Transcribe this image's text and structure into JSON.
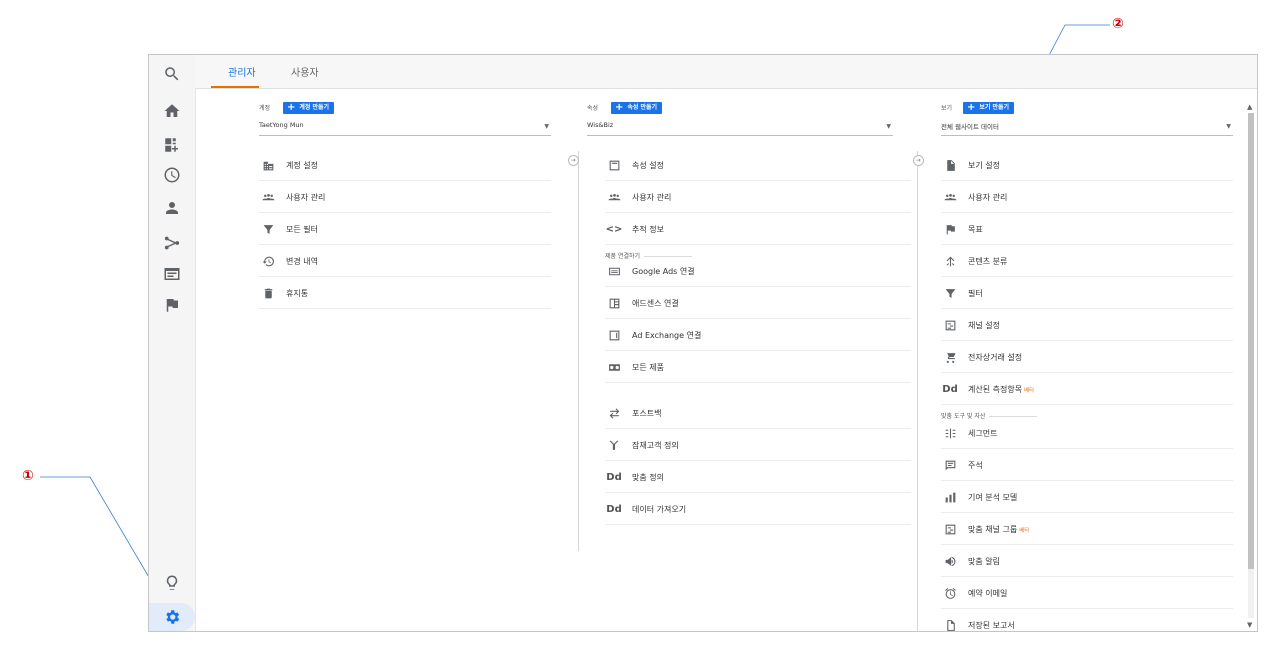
{
  "tabs": [
    {
      "label": "관리자"
    },
    {
      "label": "사용자"
    }
  ],
  "account": {
    "header": "계정",
    "create_label": "계정 만들기",
    "selected": "TaetYong Mun",
    "items": [
      {
        "label": "계정 설정",
        "icon": "building-icon"
      },
      {
        "label": "사용자 관리",
        "icon": "people-icon"
      },
      {
        "label": "모든 필터",
        "icon": "filter-icon"
      },
      {
        "label": "변경 내역",
        "icon": "history-icon"
      },
      {
        "label": "휴지통",
        "icon": "trash-icon"
      }
    ]
  },
  "property": {
    "header": "속성",
    "create_label": "속성 만들기",
    "selected": "Wis&Biz",
    "items": [
      {
        "label": "속성 설정",
        "icon": "window-icon"
      },
      {
        "label": "사용자 관리",
        "icon": "people-icon"
      },
      {
        "label": "추적 정보",
        "icon": "code-icon"
      }
    ],
    "product_section": "제품 연결하기",
    "product_items": [
      {
        "label": "Google Ads 연결",
        "icon": "ads-icon"
      },
      {
        "label": "애드센스 연결",
        "icon": "adsense-icon"
      },
      {
        "label": "Ad Exchange 연결",
        "icon": "window-icon"
      },
      {
        "label": "모든 제품",
        "icon": "all-products-icon"
      }
    ],
    "extra_items": [
      {
        "label": "포스트백",
        "icon": "postback-icon"
      },
      {
        "label": "잠재고객 정의",
        "icon": "audience-icon"
      },
      {
        "label": "맞춤 정의",
        "icon": "dd-icon",
        "glyph": "Dd"
      },
      {
        "label": "데이터 가져오기",
        "icon": "dd-icon",
        "glyph": "Dd"
      }
    ]
  },
  "view": {
    "header": "보기",
    "create_label": "보기 만들기",
    "selected": "전체 웹사이트 데이터",
    "items": [
      {
        "label": "보기 설정",
        "icon": "document-icon"
      },
      {
        "label": "사용자 관리",
        "icon": "people-icon"
      },
      {
        "label": "목표",
        "icon": "flag-icon"
      },
      {
        "label": "콘텐츠 분류",
        "icon": "grouping-icon"
      },
      {
        "label": "필터",
        "icon": "filter-icon"
      },
      {
        "label": "채널 설정",
        "icon": "channel-icon"
      },
      {
        "label": "전자상거래 설정",
        "icon": "cart-icon"
      },
      {
        "label": "계산된 측정항목",
        "icon": "dd-icon",
        "glyph": "Dd",
        "badge": "베타"
      }
    ],
    "tools_section": "맞춤 도구 및 자산",
    "tools_items": [
      {
        "label": "세그먼트",
        "icon": "segment-icon"
      },
      {
        "label": "주석",
        "icon": "comment-icon"
      },
      {
        "label": "기여 분석 모델",
        "icon": "bar-chart-icon"
      },
      {
        "label": "맞춤 채널 그룹",
        "icon": "channel-icon",
        "badge": "베타"
      },
      {
        "label": "맞춤 알림",
        "icon": "megaphone-icon"
      },
      {
        "label": "예약 이메일",
        "icon": "alarm-icon"
      },
      {
        "label": "저장된 보고서",
        "icon": "saved-report-icon"
      }
    ]
  },
  "callouts": {
    "one": "①",
    "two": "②"
  },
  "colors": {
    "accent": "#1a73e8",
    "tab_underline": "#e37400",
    "beta": "#e8711a"
  }
}
